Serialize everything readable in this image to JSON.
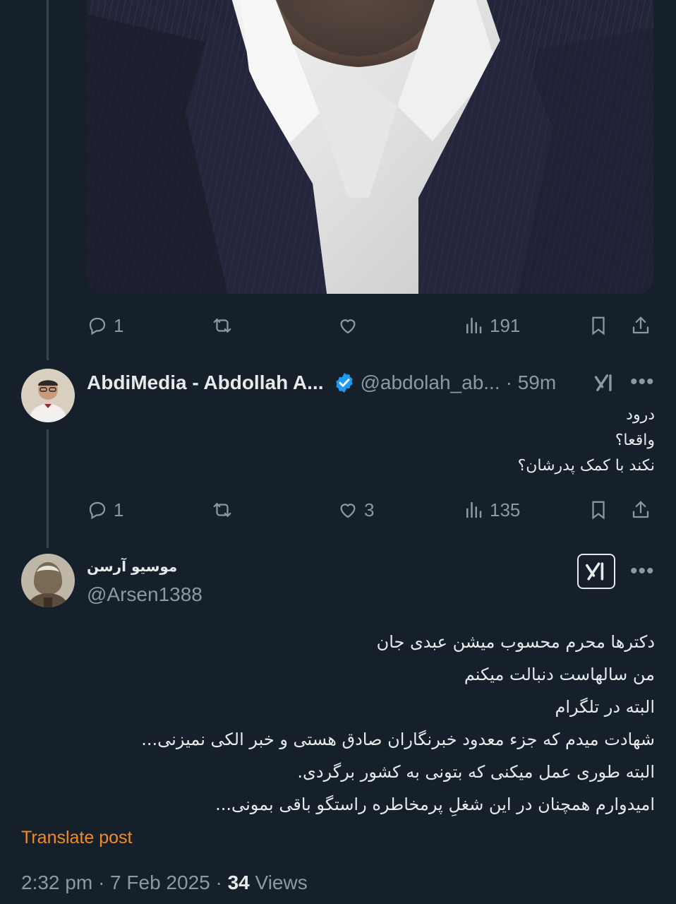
{
  "prev_tweet": {
    "actions": {
      "replies": "1",
      "reposts": "",
      "likes": "",
      "views": "191"
    }
  },
  "reply1": {
    "display_name": "AbdiMedia - Abdollah A...",
    "handle": "@abdolah_ab...",
    "time": "· 59m",
    "lines": [
      "درود",
      "واقعا؟",
      "نکند با کمک پدرشان؟"
    ],
    "actions": {
      "replies": "1",
      "reposts": "",
      "likes": "3",
      "views": "135"
    }
  },
  "main_tweet": {
    "display_name": "موسیو آرسن",
    "handle": "@Arsen1388",
    "lines": [
      "دکترها محرم محسوب میشن عبدی جان",
      "من سالهاست دنبالت میکنم",
      "البته در تلگرام",
      "شهادت میدم که جزء معدود خبرنگاران صادق هستی و خبر الکی نمیزنی...",
      "البته طوری عمل میکنی که بتونی به کشور برگردی.",
      "امیدوارم همچنان در این شغلِ پرمخاطره راستگو باقی بمونی..."
    ],
    "translate_label": "Translate post",
    "timestamp": "2:32 pm · 7 Feb 2025 · ",
    "views_count": "34",
    "views_label": " Views"
  },
  "icons": {
    "reply": "reply-icon",
    "repost": "repost-icon",
    "like": "heart-icon",
    "views": "views-icon",
    "bookmark": "bookmark-icon",
    "share": "share-icon",
    "grok": "grok-icon",
    "more": "more-icon",
    "verified": "verified-badge-icon"
  },
  "colors": {
    "background": "#15202b",
    "text": "#e7e9ea",
    "muted": "#8b98a5",
    "verified": "#1d9bf0",
    "translate": "#f28b26"
  }
}
